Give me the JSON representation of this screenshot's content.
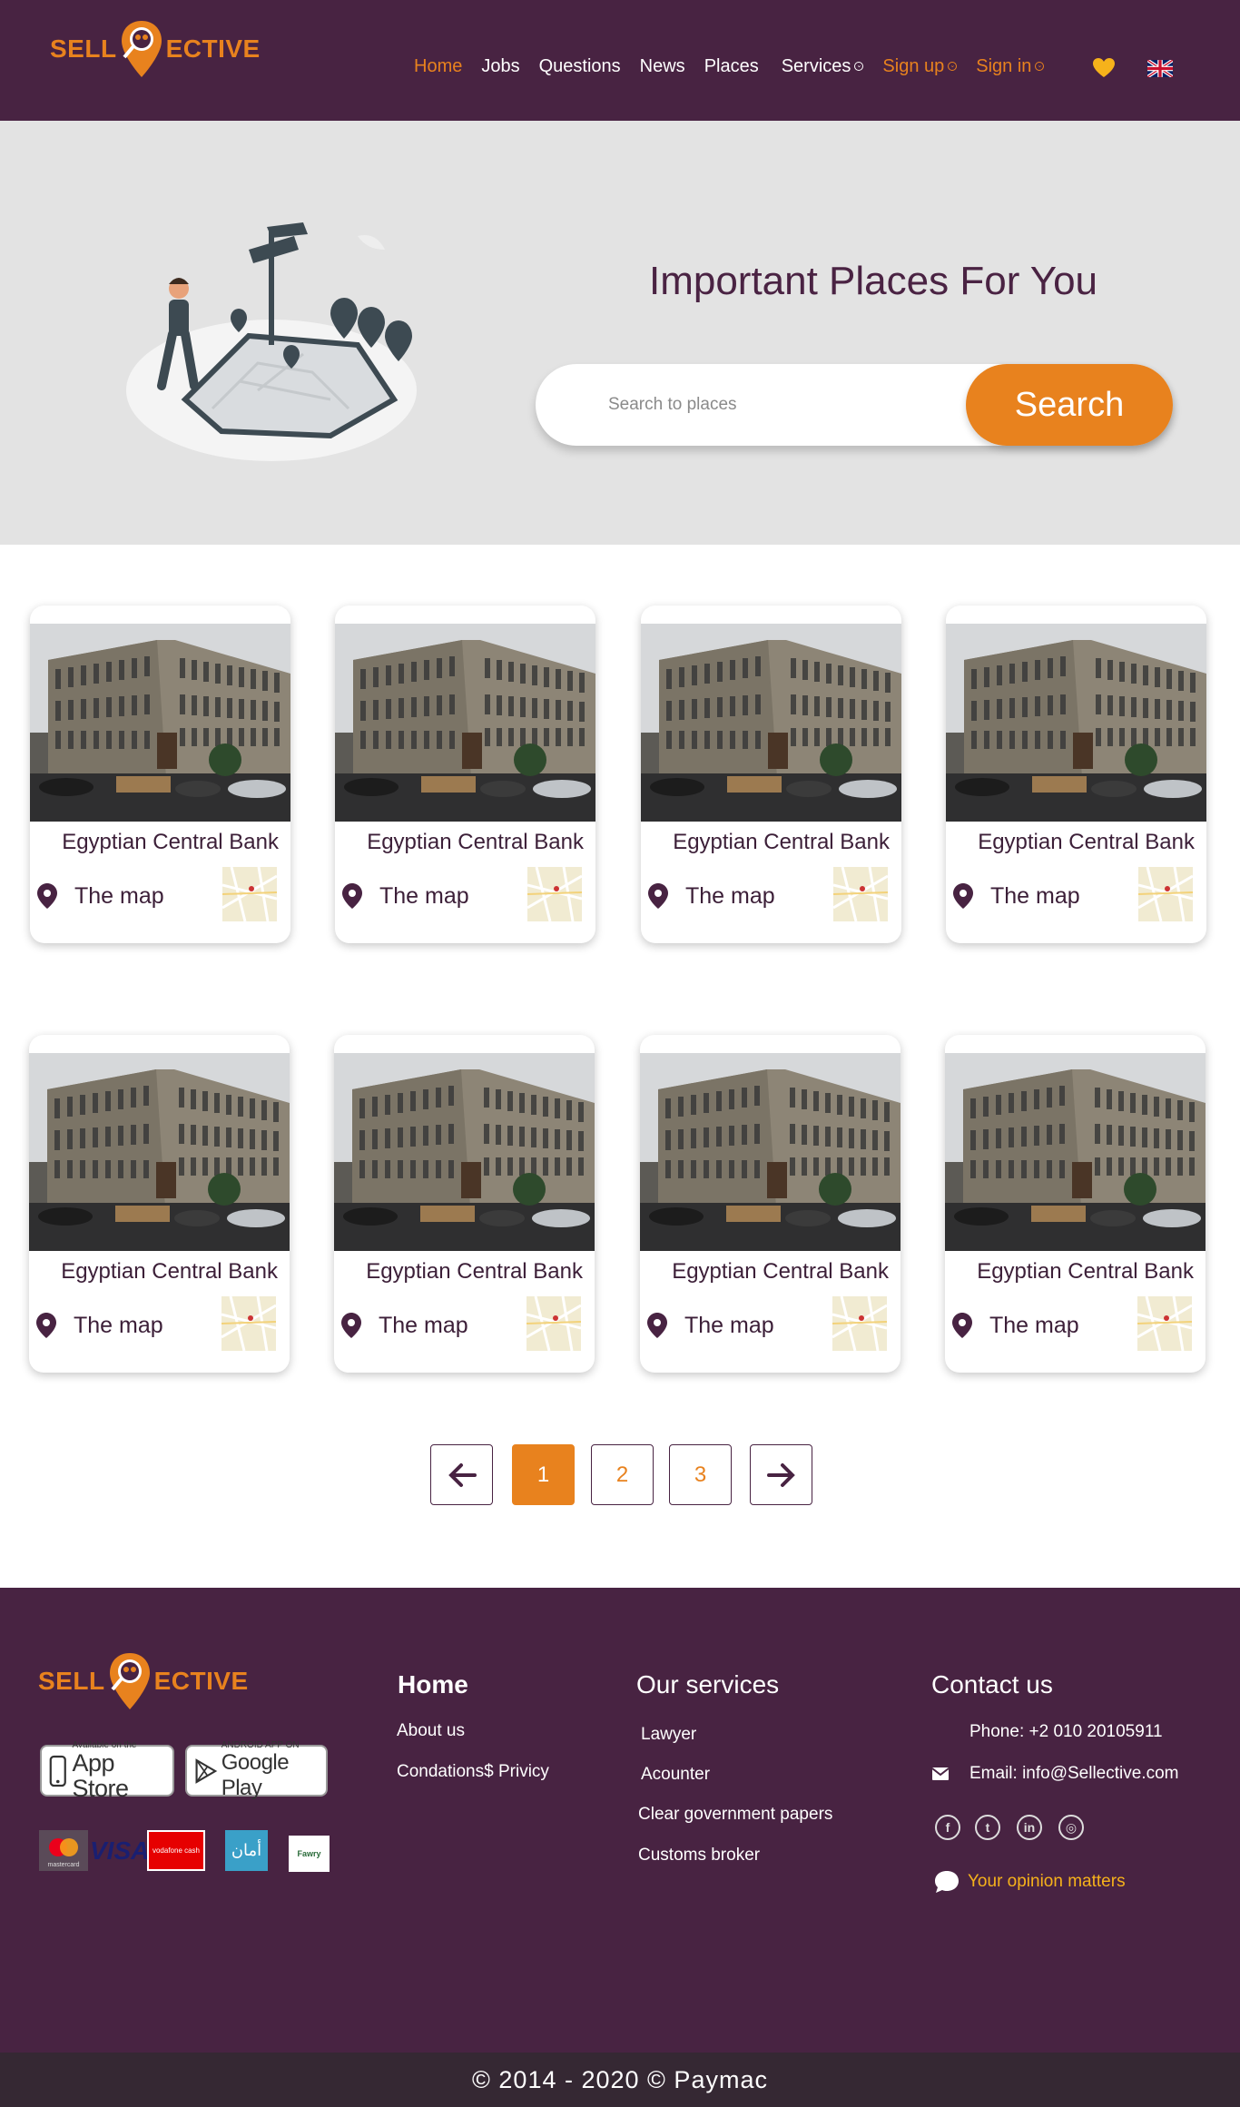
{
  "brand": {
    "part1": "SELL",
    "part2": "ECTIVE"
  },
  "nav": {
    "items": [
      {
        "label": "Home",
        "active": true
      },
      {
        "label": "Jobs"
      },
      {
        "label": "Questions"
      },
      {
        "label": "News"
      },
      {
        "label": "Places"
      },
      {
        "label": "Services",
        "dropdown": true
      },
      {
        "label": "Sign up",
        "dropdown": true
      },
      {
        "label": "Sign in",
        "dropdown": true
      }
    ],
    "heart_icon": "heart-icon",
    "language_flag": "uk-flag-icon"
  },
  "hero": {
    "title": "Important Places For You",
    "search_placeholder": "Search to places",
    "search_button": "Search"
  },
  "cards": [
    {
      "title": "Egyptian Central Bank",
      "map_label": "The map"
    },
    {
      "title": "Egyptian Central Bank",
      "map_label": "The map"
    },
    {
      "title": "Egyptian Central Bank",
      "map_label": "The map"
    },
    {
      "title": "Egyptian Central Bank",
      "map_label": "The map"
    },
    {
      "title": "Egyptian Central Bank",
      "map_label": "The map"
    },
    {
      "title": "Egyptian Central Bank",
      "map_label": "The map"
    },
    {
      "title": "Egyptian Central Bank",
      "map_label": "The map"
    },
    {
      "title": "Egyptian Central Bank",
      "map_label": "The map"
    }
  ],
  "pagination": {
    "pages": [
      "1",
      "2",
      "3"
    ],
    "current": "1",
    "prev": "←",
    "next": "→"
  },
  "footer": {
    "brand": {
      "part1": "SELL",
      "part2": "ECTIVE"
    },
    "app_store": {
      "small": "Available on the",
      "big": "App Store"
    },
    "google_play": {
      "small": "ANDROID APP ON",
      "big": "Google Play"
    },
    "payments": [
      "mastercard",
      "VISA",
      "vodafone cash",
      "أمان",
      "Fawry"
    ],
    "col1": {
      "heading": "Home",
      "links": [
        "About us",
        "Condations$ Privicy"
      ]
    },
    "col2": {
      "heading": "Our services",
      "links": [
        "Lawyer",
        "Acounter",
        "Clear government papers",
        "Customs broker"
      ]
    },
    "col3": {
      "heading": "Contact us",
      "phone": "Phone: +2 010 20105911",
      "email": "Email: info@Sellective.com",
      "opinion": "Your opinion matters"
    },
    "copyright": "© 2014 - 2020 © Paymac"
  },
  "colors": {
    "primary": "#482342",
    "accent": "#e8821e",
    "hero_bg": "#e3e3e3",
    "copyright_bg": "#352833"
  }
}
